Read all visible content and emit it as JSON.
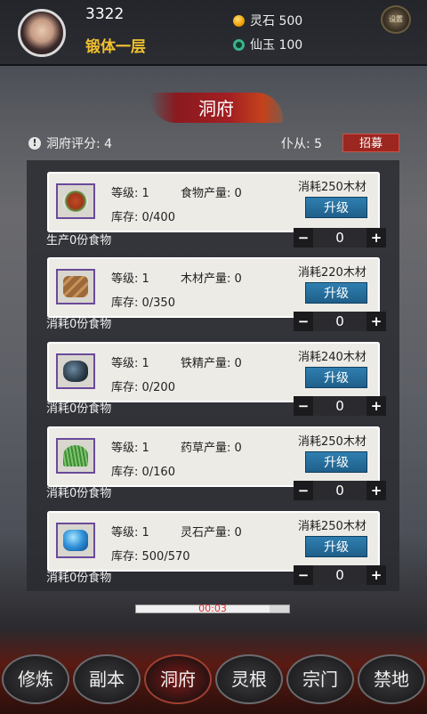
{
  "player": {
    "id": "3322",
    "rank": "锻体一层"
  },
  "resources": {
    "spirit_stone": "灵石 500",
    "immortal_jade": "仙玉 100"
  },
  "settings_label": "设置",
  "title": "洞府",
  "cave_score": "洞府评分: 4",
  "servants": "仆从: 5",
  "recruit_label": "招募",
  "buildings": [
    {
      "level": "等级: 1",
      "production": "食物产量: 0",
      "stock": "库存: 0/400",
      "cost": "消耗250木材",
      "upgrade": "升级",
      "status": "生产0份食物",
      "assigned": "0",
      "icon": "food-icon"
    },
    {
      "level": "等级: 1",
      "production": "木材产量: 0",
      "stock": "库存: 0/350",
      "cost": "消耗220木材",
      "upgrade": "升级",
      "status": "消耗0份食物",
      "assigned": "0",
      "icon": "wood-icon"
    },
    {
      "level": "等级: 1",
      "production": "铁精产量: 0",
      "stock": "库存: 0/200",
      "cost": "消耗240木材",
      "upgrade": "升级",
      "status": "消耗0份食物",
      "assigned": "0",
      "icon": "iron-ore-icon"
    },
    {
      "level": "等级: 1",
      "production": "药草产量: 0",
      "stock": "库存: 0/160",
      "cost": "消耗250木材",
      "upgrade": "升级",
      "status": "消耗0份食物",
      "assigned": "0",
      "icon": "herb-icon"
    },
    {
      "level": "等级: 1",
      "production": "灵石产量: 0",
      "stock": "库存: 500/570",
      "cost": "消耗250木材",
      "upgrade": "升级",
      "status": "消耗0份食物",
      "assigned": "0",
      "icon": "spirit-gem-icon"
    }
  ],
  "timer": {
    "text": "00:03",
    "progress": 0.87
  },
  "nav": [
    {
      "label": "修炼"
    },
    {
      "label": "副本"
    },
    {
      "label": "洞府",
      "active": true
    },
    {
      "label": "灵根"
    },
    {
      "label": "宗门"
    },
    {
      "label": "禁地"
    }
  ],
  "stepper": {
    "minus": "−",
    "plus": "+"
  }
}
